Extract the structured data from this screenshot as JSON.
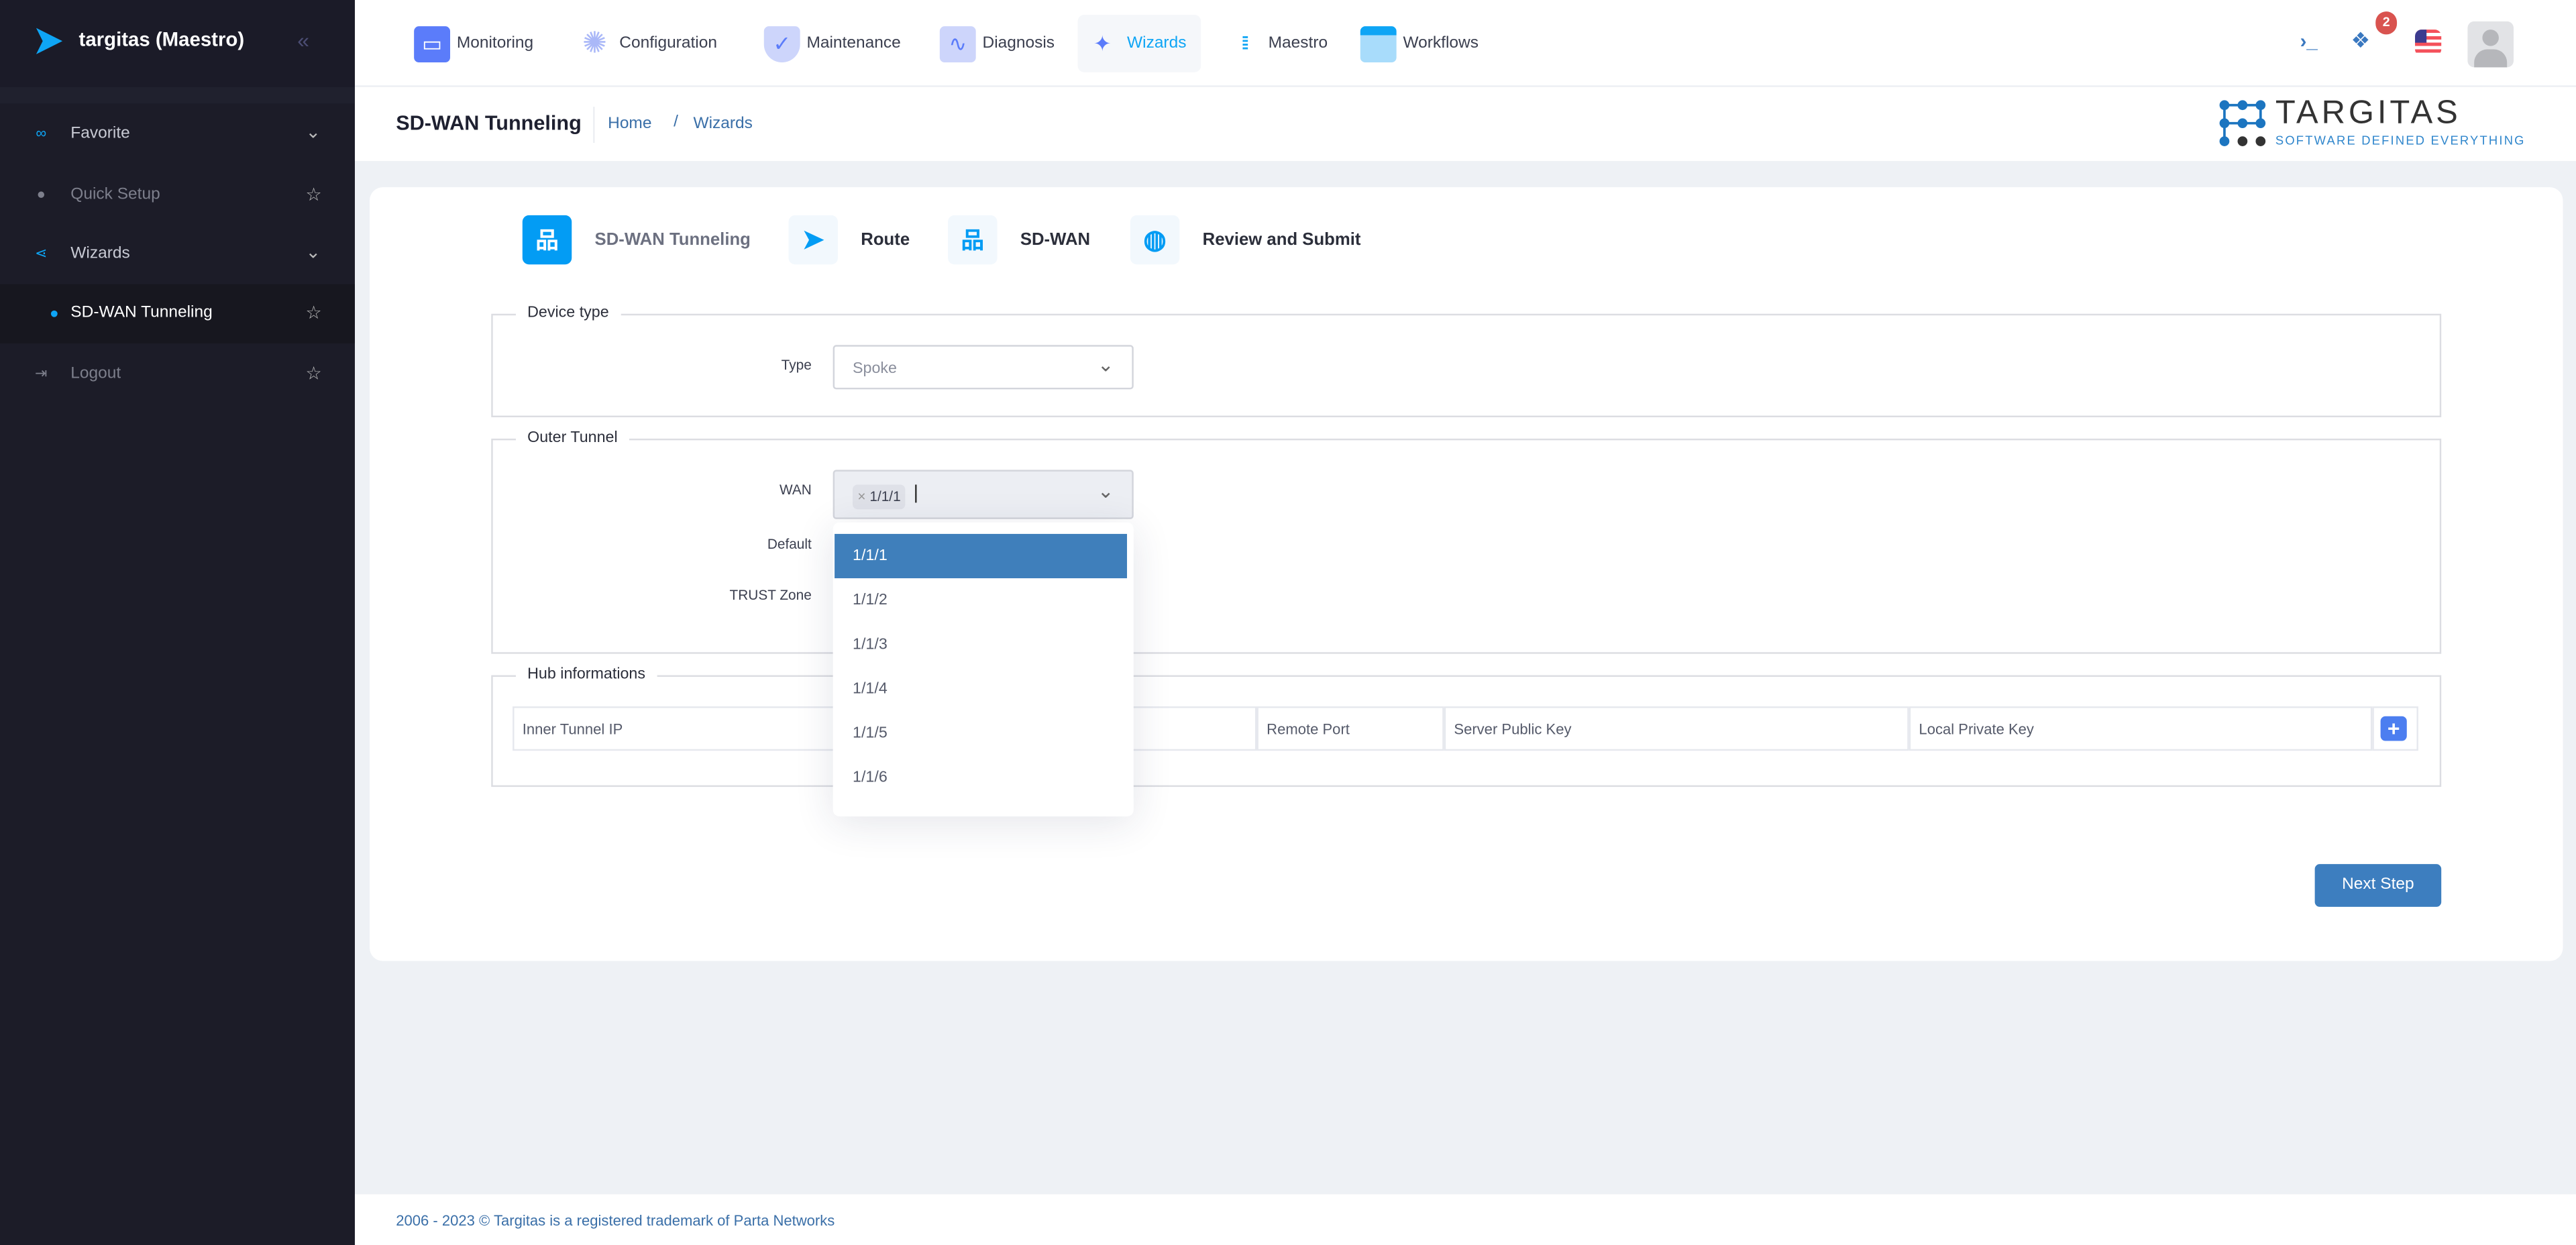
{
  "sidebar": {
    "brand": "targitas (Maestro)",
    "items": [
      {
        "label": "Favorite",
        "icon": "link-icon"
      },
      {
        "label": "Quick Setup",
        "icon": "clock-icon"
      },
      {
        "label": "Wizards",
        "icon": "share-icon"
      },
      {
        "label": "SD-WAN Tunneling",
        "icon": "dot-icon"
      },
      {
        "label": "Logout",
        "icon": "logout-icon"
      }
    ]
  },
  "topnav": {
    "items": [
      {
        "label": "Monitoring"
      },
      {
        "label": "Configuration"
      },
      {
        "label": "Maintenance"
      },
      {
        "label": "Diagnosis"
      },
      {
        "label": "Wizards"
      },
      {
        "label": "Maestro"
      },
      {
        "label": "Workflows"
      }
    ],
    "active": "Wizards",
    "notification_count": "2"
  },
  "header": {
    "title": "SD-WAN Tunneling",
    "breadcrumb": [
      "Home",
      "Wizards"
    ],
    "separator": "/"
  },
  "logo": {
    "name": "TARGITAS",
    "tagline": "SOFTWARE DEFINED EVERYTHING"
  },
  "steps": [
    {
      "label": "SD-WAN Tunneling",
      "active": true
    },
    {
      "label": "Route"
    },
    {
      "label": "SD-WAN"
    },
    {
      "label": "Review and Submit"
    }
  ],
  "device_type": {
    "legend": "Device type",
    "type_label": "Type",
    "type_value": "Spoke"
  },
  "outer_tunnel": {
    "legend": "Outer Tunnel",
    "wan_label": "WAN",
    "wan_tag": "1/1/1",
    "tag_remove": "×",
    "default_label": "Default",
    "trust_label": "TRUST Zone",
    "options": [
      "1/1/1",
      "1/1/2",
      "1/1/3",
      "1/1/4",
      "1/1/5",
      "1/1/6"
    ],
    "selected": "1/1/1"
  },
  "hub": {
    "legend": "Hub informations",
    "columns": [
      "Inner Tunnel IP",
      "",
      "Remote Port",
      "Server Public Key",
      "Local Private Key"
    ],
    "add": "+"
  },
  "next_label": "Next Step",
  "footer": "2006 - 2023 © Targitas is a registered trademark of Parta Networks",
  "colors": {
    "accent": "#3f7fbb",
    "sidebar": "#1c1c28",
    "stepIcon": "#039cf4",
    "badge": "#d9534f"
  }
}
